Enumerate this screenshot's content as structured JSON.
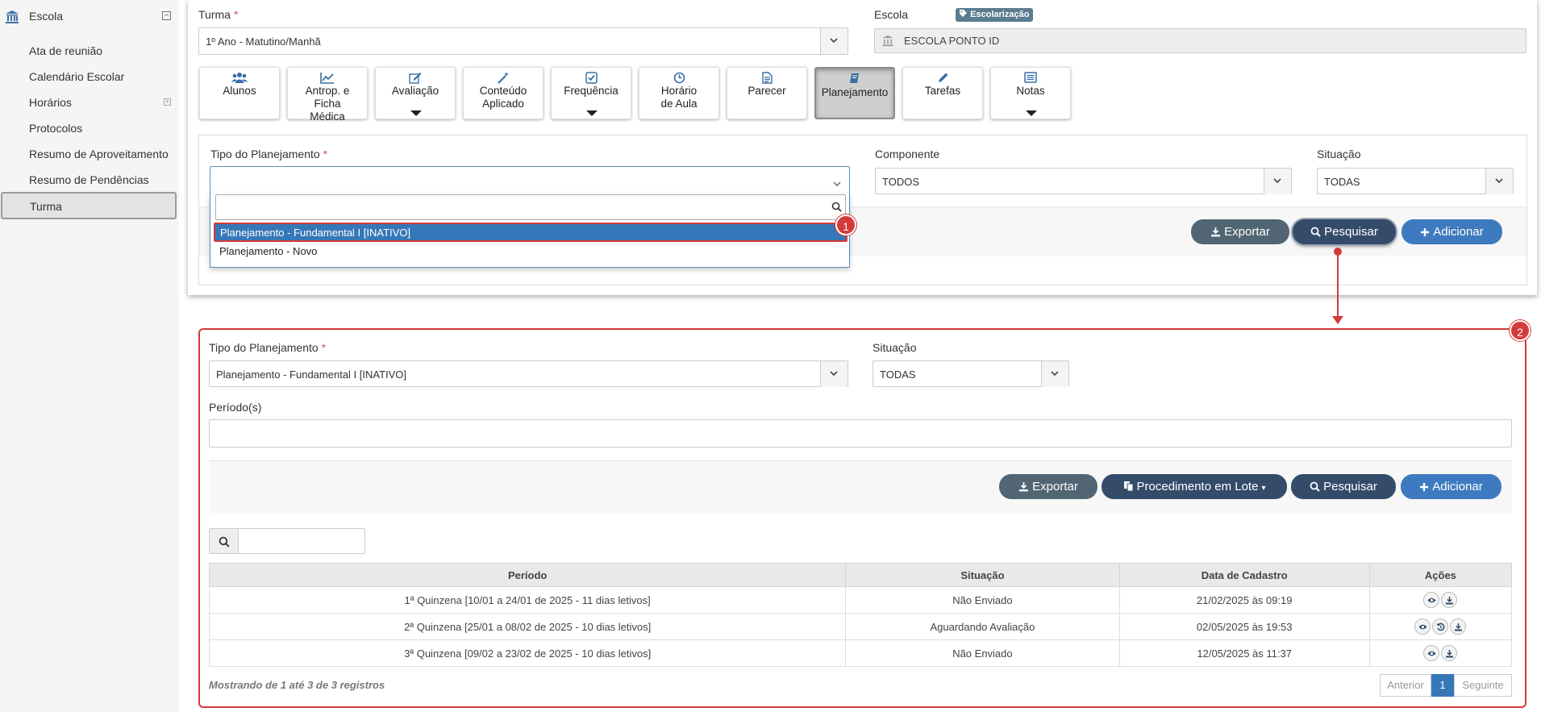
{
  "sidebar": {
    "title": "Escola",
    "items": [
      {
        "label": "Ata de reunião"
      },
      {
        "label": "Calendário Escolar"
      },
      {
        "label": "Horários"
      },
      {
        "label": "Protocolos"
      },
      {
        "label": "Resumo de Aproveitamento"
      },
      {
        "label": "Resumo de Pendências"
      },
      {
        "label": "Turma"
      }
    ]
  },
  "top": {
    "turma_label": "Turma",
    "required_mark": "*",
    "turma_value": "1º Ano - Matutino/Manhã",
    "badge": "Escolarização",
    "escola_label": "Escola",
    "escola_value": "ESCOLA PONTO ID",
    "tiles": [
      {
        "label": "Alunos"
      },
      {
        "label": "Antrop. e Ficha Médica"
      },
      {
        "label": "Avaliação"
      },
      {
        "label": "Conteúdo Aplicado"
      },
      {
        "label": "Frequência"
      },
      {
        "label": "Horário de Aula"
      },
      {
        "label": "Parecer"
      },
      {
        "label": "Planejamento"
      },
      {
        "label": "Tarefas"
      },
      {
        "label": "Notas"
      }
    ],
    "filters": {
      "tipo_label": "Tipo do Planejamento",
      "componente_label": "Componente",
      "componente_value": "TODOS",
      "situacao_label": "Situação",
      "situacao_value": "TODAS"
    },
    "dropdown": {
      "options": [
        "Planejamento - Fundamental I [INATIVO]",
        "Planejamento - Novo"
      ]
    },
    "buttons": {
      "exportar": "Exportar",
      "pesquisar": "Pesquisar",
      "adicionar": "Adicionar"
    }
  },
  "markers": {
    "one": "1",
    "two": "2"
  },
  "bottom": {
    "tipo_label": "Tipo do Planejamento",
    "tipo_value": "Planejamento - Fundamental I [INATIVO]",
    "situacao_label": "Situação",
    "situacao_value": "TODAS",
    "periodos_label": "Período(s)",
    "buttons": {
      "exportar": "Exportar",
      "lote": "Procedimento em Lote",
      "pesquisar": "Pesquisar",
      "adicionar": "Adicionar"
    },
    "table": {
      "headers": [
        "Período",
        "Situação",
        "Data de Cadastro",
        "Ações"
      ],
      "rows": [
        {
          "periodo": "1ª Quinzena [10/01 a 24/01 de 2025 - 11 dias letivos]",
          "situacao": "Não Enviado",
          "data": "21/02/2025 às 09:19"
        },
        {
          "periodo": "2ª Quinzena [25/01 a 08/02 de 2025 - 10 dias letivos]",
          "situacao": "Aguardando Avaliação",
          "data": "02/05/2025 às 19:53"
        },
        {
          "periodo": "3ª Quinzena [09/02 a 23/02 de 2025 - 10 dias letivos]",
          "situacao": "Não Enviado",
          "data": "12/05/2025 às 11:37"
        }
      ]
    },
    "footer": "Mostrando de 1 até 3 de 3 registros",
    "pager": {
      "prev": "Anterior",
      "page": "1",
      "next": "Seguinte"
    }
  }
}
